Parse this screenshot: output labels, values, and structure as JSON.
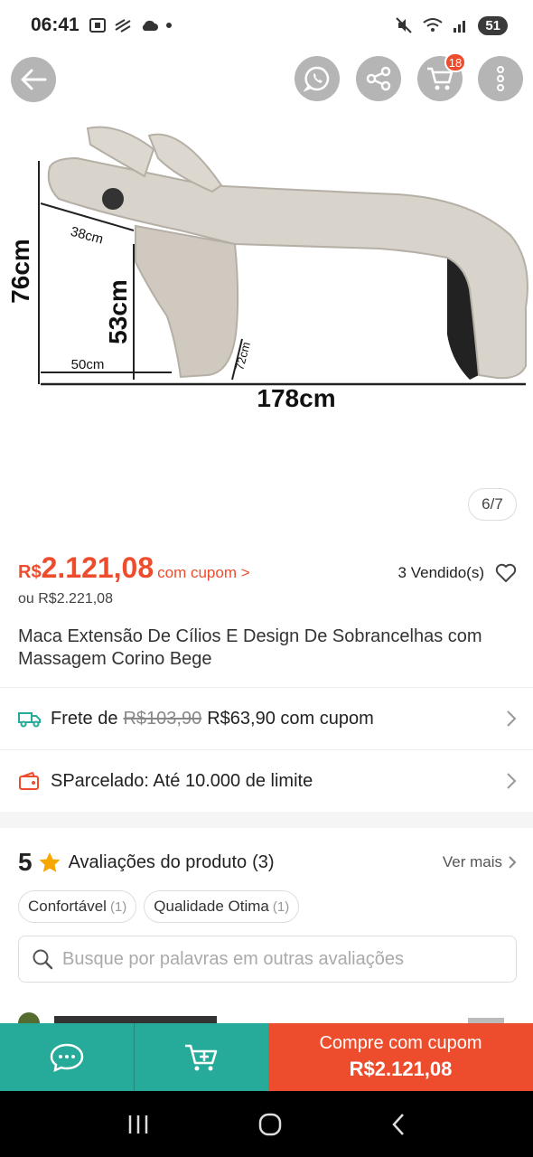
{
  "status_bar": {
    "time": "06:41",
    "battery": "51"
  },
  "top_actions": {
    "cart_count": "18"
  },
  "product": {
    "image_counter": "6/7",
    "image_dimensions": {
      "height_total": "76cm",
      "height_seat": "53cm",
      "headrest": "38cm",
      "base": "50cm",
      "leg": "72cm",
      "length": "178cm"
    },
    "currency": "R$",
    "price": "2.121,08",
    "coupon_link": "com cupom >",
    "sold": "3 Vendido(s)",
    "old_price": "ou R$2.221,08",
    "title": "Maca Extensão De Cílios E Design De Sobrancelhas com Massagem Corino Bege"
  },
  "shipping": {
    "prefix": "Frete de",
    "original": "R$103,90",
    "discounted": "R$63,90 com cupom"
  },
  "installments": {
    "label": "SParcelado: Até 10.000 de limite"
  },
  "reviews": {
    "rating": "5",
    "title": "Avaliações do produto",
    "count": "(3)",
    "see_more": "Ver mais",
    "tags": [
      {
        "label": "Confortável",
        "count": "(1)"
      },
      {
        "label": "Qualidade Otima",
        "count": "(1)"
      }
    ],
    "search_placeholder": "Busque por palavras em outras avaliações"
  },
  "bottom_bar": {
    "buy_label": "Compre com cupom",
    "buy_price": "R$2.121,08"
  },
  "colors": {
    "accent": "#ee4d2d",
    "teal": "#26aa99"
  }
}
